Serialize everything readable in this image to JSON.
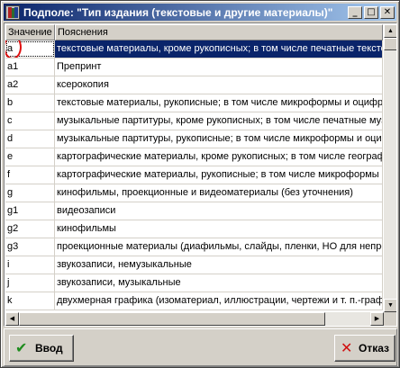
{
  "window": {
    "title": "Подполе: \"Тип издания (текстовые и другие материалы)\"",
    "minimize_glyph": "_",
    "maximize_glyph": "□",
    "close_glyph": "✕"
  },
  "table": {
    "columns": [
      "Значение",
      "Пояснения"
    ],
    "selected_row": 0,
    "rows": [
      {
        "value": "a",
        "description": "текстовые материалы, кроме рукописных; в том числе печатные текстовые материалы"
      },
      {
        "value": "a1",
        "description": "Препринт"
      },
      {
        "value": "a2",
        "description": "ксерокопия"
      },
      {
        "value": "b",
        "description": "текстовые материалы, рукописные; в том числе микроформы и оцифрованные"
      },
      {
        "value": "c",
        "description": "музыкальные партитуры, кроме рукописных; в том числе печатные музыкальные"
      },
      {
        "value": "d",
        "description": "музыкальные партитуры, рукописные; в том числе микроформы и оцифрованные"
      },
      {
        "value": "e",
        "description": "картографические материалы, кроме рукописных; в том числе географические"
      },
      {
        "value": "f",
        "description": "картографические материалы, рукописные; в том числе микроформы и оцифрованные"
      },
      {
        "value": "g",
        "description": "кинофильмы, проекционные и видеоматериалы (без уточнения)"
      },
      {
        "value": "g1",
        "description": "видеозаписи"
      },
      {
        "value": "g2",
        "description": "кинофильмы"
      },
      {
        "value": "g3",
        "description": "проекционные материалы (диафильмы, слайды, пленки, НО для непрозрачных"
      },
      {
        "value": "i",
        "description": "звукозаписи, немузыкальные"
      },
      {
        "value": "j",
        "description": "звукозаписи, музыкальные"
      },
      {
        "value": "k",
        "description": "двухмерная графика (изоматериал, иллюстрации, чертежи и т. п.-графика"
      }
    ]
  },
  "scroll": {
    "up_glyph": "▲",
    "down_glyph": "▼"
  },
  "buttons": {
    "ok": {
      "label": "Ввод",
      "icon": "checkmark-icon",
      "glyph": "✔",
      "color": "#1e8c1e"
    },
    "cancel": {
      "label": "Отказ",
      "icon": "cross-icon",
      "glyph": "✕",
      "color": "#d01010"
    }
  },
  "colors": {
    "title_bar": "#0a246a",
    "selection": "#0a246a",
    "highlight_circle": "#e01010"
  }
}
